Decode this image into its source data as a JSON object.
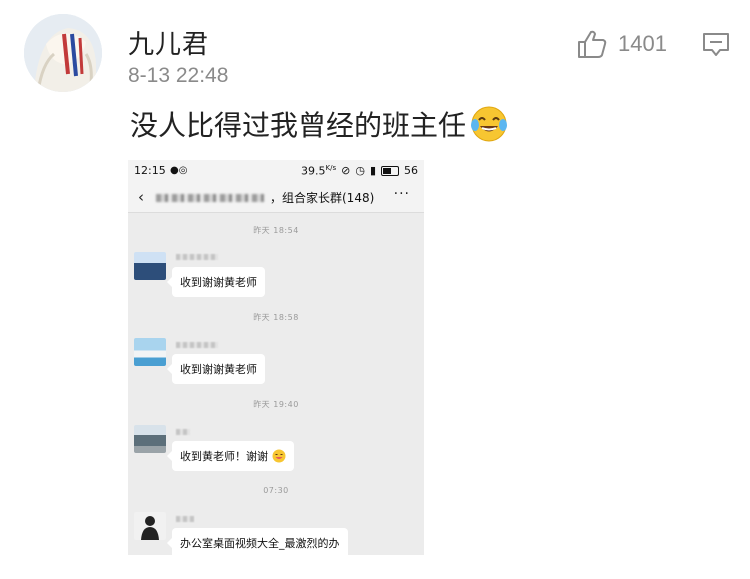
{
  "post": {
    "username": "九儿君",
    "timestamp": "8-13 22:48",
    "like_count": "1401",
    "text": "没人比得过我曾经的班主任",
    "text_emoji_icon": "laugh-cry-emoji-icon"
  },
  "screenshot": {
    "status": {
      "time": "12:15",
      "battery_speed": "39.5",
      "battery_speed_unit": "K/s",
      "battery_level": "56"
    },
    "chat": {
      "group_title": "，组合家长群(148)"
    },
    "messages": [
      {
        "time": "昨天 18:54",
        "text": "收到谢谢黄老师",
        "emoji": false
      },
      {
        "time": "昨天 18:58",
        "text": "收到谢谢黄老师",
        "emoji": false
      },
      {
        "time": "昨天 19:40",
        "text": "收到黄老师！谢谢",
        "emoji": true
      },
      {
        "time": "07:30",
        "text": "办公室桌面视频大全_最激烈的办",
        "emoji": false
      }
    ]
  },
  "colors": {
    "accent_gray": "#8a8a8a",
    "chat_background": "#ececec",
    "bubble": "#ffffff"
  }
}
